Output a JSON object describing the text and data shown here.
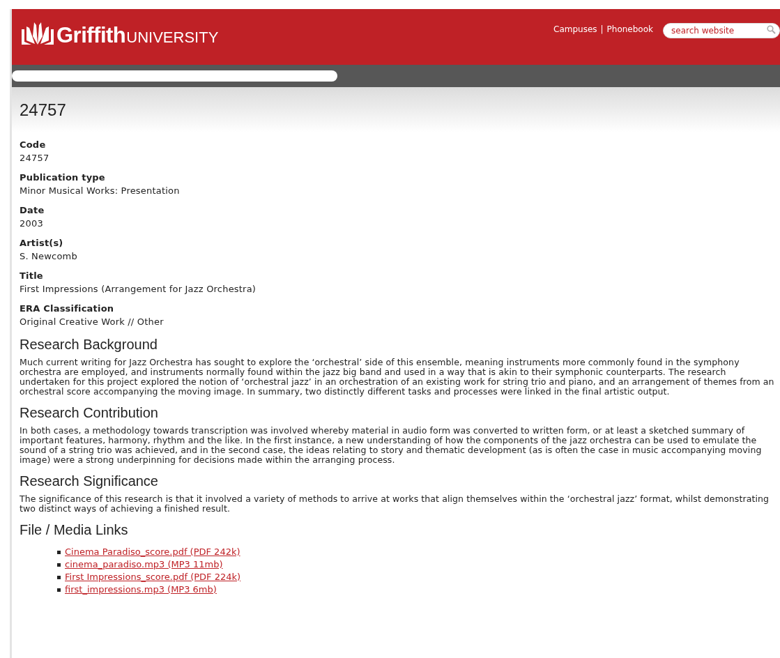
{
  "header": {
    "logo_bold": "Griffith",
    "logo_light": "UNIVERSITY",
    "links": [
      "Campuses",
      "Phonebook"
    ],
    "separator": "|",
    "search": {
      "placeholder": "search website"
    }
  },
  "page_title": "24757",
  "fields": [
    {
      "label": "Code",
      "value": "24757"
    },
    {
      "label": "Publication type",
      "value": "Minor Musical Works: Presentation"
    },
    {
      "label": "Date",
      "value": "2003"
    },
    {
      "label": "Artist(s)",
      "value": "S. Newcomb"
    },
    {
      "label": "Title",
      "value": "First Impressions (Arrangement for Jazz Orchestra)"
    },
    {
      "label": "ERA Classification",
      "value": "Original Creative Work // Other"
    }
  ],
  "sections": [
    {
      "heading": "Research Background",
      "text": "Much current writing for Jazz Orchestra has sought to explore the ‘orchestral’ side of this ensemble, meaning instruments more commonly found in the symphony orchestra are employed, and instruments normally found within the jazz big band and used in a way that is akin to their symphonic counterparts. The research undertaken for this project explored the notion of ‘orchestral jazz’ in an orchestration of an existing work for string trio and piano, and an arrangement of themes from an orchestral score accompanying the moving image. In summary, two distinctly different tasks and processes were linked in the final artistic output."
    },
    {
      "heading": "Research Contribution",
      "text": "In both cases, a methodology towards transcription was involved whereby material in audio form was converted to written form, or at least a sketched summary of important features, harmony, rhythm and the like. In the first instance, a new understanding of how the components of the jazz orchestra can be used to emulate the sound of a string trio was achieved, and in the second case, the ideas relating to story and thematic development (as is often the case in music accompanying moving image) were a strong underpinning for decisions made within the arranging process."
    },
    {
      "heading": "Research Significance",
      "text": "The significance of this research is that it involved a variety of methods to arrive at works that align themselves within the ‘orchestral jazz’ format, whilst demonstrating two distinct ways of achieving a finished result."
    }
  ],
  "media": {
    "heading": "File / Media Links",
    "links": [
      "Cinema Paradiso_score.pdf (PDF 242k)",
      "cinema_paradiso.mp3 (MP3 11mb)",
      "First Impressions_score.pdf (PDF 224k)",
      "first_impressions.mp3 (MP3 6mb)"
    ]
  }
}
